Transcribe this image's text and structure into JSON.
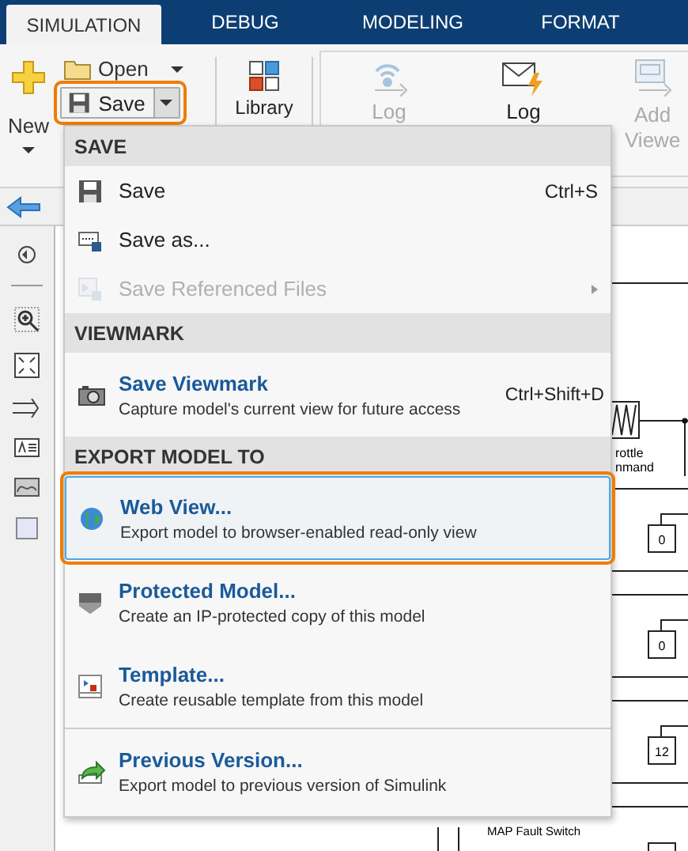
{
  "tabs": [
    {
      "label": "SIMULATION",
      "selected": true
    },
    {
      "label": "DEBUG",
      "selected": false
    },
    {
      "label": "MODELING",
      "selected": false
    },
    {
      "label": "FORMAT",
      "selected": false
    }
  ],
  "toolstrip": {
    "new": {
      "label": "New"
    },
    "open": {
      "label": "Open"
    },
    "save": {
      "label": "Save",
      "highlighted": true
    },
    "library": {
      "label": "Library"
    },
    "tools": [
      {
        "label": "Log",
        "disabled": true
      },
      {
        "label": "Log",
        "disabled": false
      },
      {
        "label": "Add",
        "label_2": "Viewe",
        "disabled": true
      }
    ]
  },
  "menu": {
    "sections": [
      {
        "header": "SAVE",
        "items": [
          {
            "kind": "simple",
            "label": "Save",
            "shortcut": "Ctrl+S",
            "disabled": false,
            "selected": false,
            "highlighted": false
          },
          {
            "kind": "simple",
            "label": "Save as...",
            "disabled": false,
            "selected": false,
            "highlighted": false
          },
          {
            "kind": "simple",
            "label": "Save Referenced Files",
            "disabled": true,
            "submenu": true,
            "selected": false,
            "highlighted": false
          }
        ]
      },
      {
        "header": "VIEWMARK",
        "items": [
          {
            "kind": "detailed",
            "title": "Save Viewmark",
            "description": "Capture model's current view for future access",
            "shortcut": "Ctrl+Shift+D",
            "disabled": false,
            "selected": false,
            "highlighted": false
          }
        ]
      },
      {
        "header": "EXPORT MODEL TO",
        "items": [
          {
            "kind": "detailed",
            "title": "Web View...",
            "description": "Export model to browser-enabled read-only view",
            "disabled": false,
            "selected": true,
            "highlighted": true
          },
          {
            "kind": "detailed",
            "title": "Protected Model...",
            "description": "Create an IP-protected copy of this model",
            "disabled": false,
            "selected": false,
            "highlighted": false
          },
          {
            "kind": "detailed",
            "title": "Template...",
            "description": "Create reusable template from this model",
            "disabled": false,
            "selected": false,
            "highlighted": false
          },
          {
            "kind": "detailed",
            "title": "Previous Version...",
            "description": "Export model to previous version of Simulink",
            "disabled": false,
            "selected": false,
            "highlighted": false,
            "separator_before": true
          }
        ]
      }
    ]
  },
  "diagram": {
    "block_labels": [
      "rottle",
      "nmand"
    ],
    "constants": [
      "0",
      "0",
      "12"
    ],
    "switch_label": "MAP Fault Switch"
  }
}
